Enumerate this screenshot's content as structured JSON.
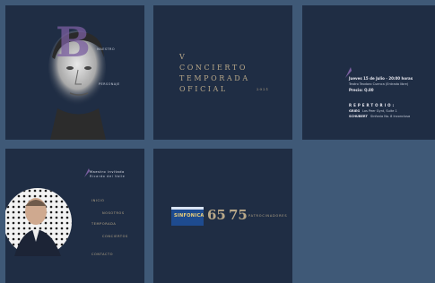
{
  "tile1": {
    "logo_letter": "B",
    "caption_top": "MAESTRO",
    "caption_bottom": "PERSONAJE"
  },
  "tile2": {
    "line1": "V",
    "line2": "CONCIERTO",
    "line3": "TEMPORADA",
    "line4": "OFICIAL",
    "year": "2021"
  },
  "tile3": {
    "date_line": "Jueves 15 de Julio - 20:00 horas",
    "venue_line1": "Teatro Teodoro Cuenca (Entrada libre)",
    "venue_line2": "Precio: Q.80",
    "section_title": "REPERTORIO:",
    "rep1_composer": "GRIEG",
    "rep1_work": "Los Peer Gynt, Suite 1",
    "rep2_composer": "SCHUBERT",
    "rep2_work": "Sinfonia No. 8 Inconclusa"
  },
  "tile4": {
    "brand_line1": "Maestro invitado",
    "brand_line2": "Ricardo del Valle",
    "menu": [
      "INICIO",
      "NOSOTROS",
      "TEMPORADA",
      "CONCIERTOS",
      "CONTACTO"
    ]
  },
  "tile5": {
    "logo1_text": "SINFONICA",
    "logo2_text": "65",
    "logo3_text": "75",
    "partners_label": "PATROCINADORES"
  }
}
